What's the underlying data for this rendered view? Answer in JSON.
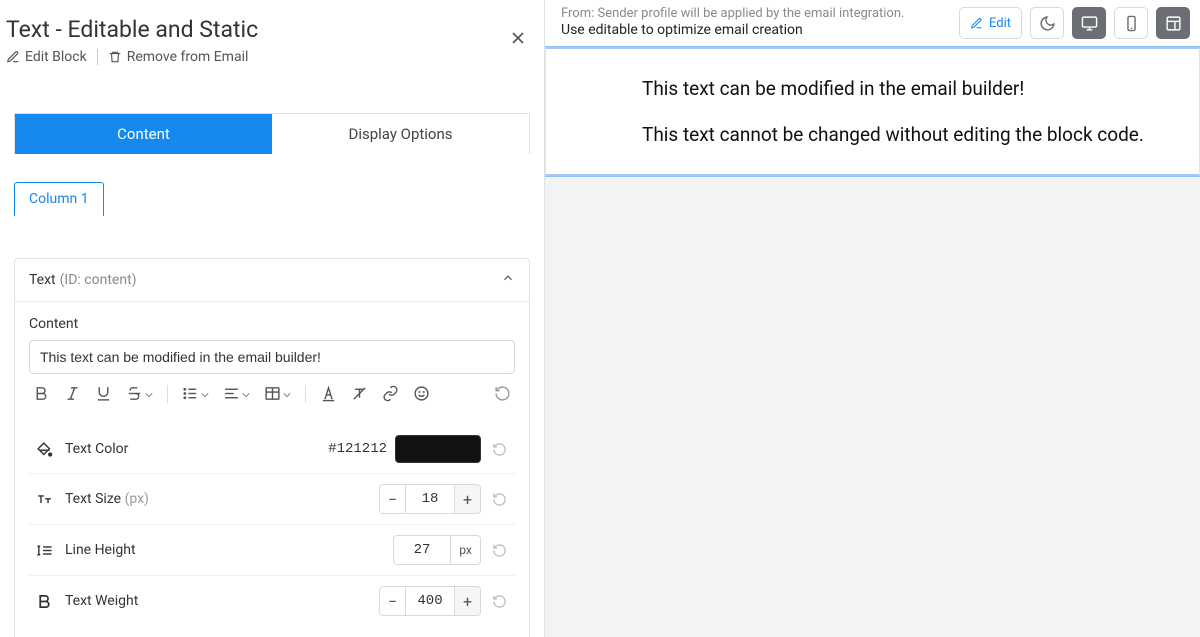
{
  "panel": {
    "title": "Text - Editable and Static",
    "edit_block": "Edit Block",
    "remove": "Remove from Email"
  },
  "tabs": {
    "content": "Content",
    "display": "Display Options"
  },
  "column_tab": "Column 1",
  "accordion": {
    "title_main": "Text",
    "title_id": "(ID: content)",
    "content_label": "Content",
    "content_value": "This text can be modified in the email builder!"
  },
  "props": {
    "text_color": {
      "label": "Text Color",
      "hex": "#121212"
    },
    "text_size": {
      "label": "Text Size ",
      "unit_hint": "(px)",
      "value": "18"
    },
    "line_height": {
      "label": "Line Height",
      "value": "27",
      "unit": "px"
    },
    "text_weight": {
      "label": "Text Weight",
      "value": "400"
    }
  },
  "top": {
    "from_label": "From:",
    "from_note": "Sender profile will be applied by the email integration.",
    "subject": "Use editable to optimize email creation",
    "edit": "Edit"
  },
  "preview": {
    "line1": "This text can be modified in the email builder!",
    "line2": "This text cannot be changed without editing the block code."
  },
  "stepper": {
    "minus": "−",
    "plus": "+"
  }
}
